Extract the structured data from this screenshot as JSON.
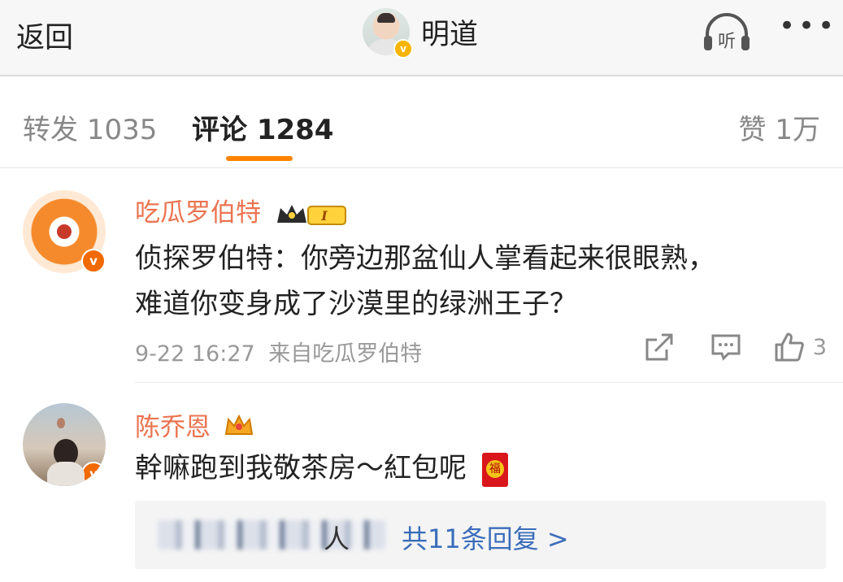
{
  "header": {
    "back_label": "返回",
    "author_name": "明道",
    "listen_label": "听",
    "more_icon": "more-dots-icon"
  },
  "tabs": {
    "repost": "转发 1035",
    "comment": "评论 1284",
    "like": "赞 1万"
  },
  "comments": [
    {
      "user": "吃瓜罗伯特",
      "badge_level": "I",
      "text_line1": "侦探罗伯特：你旁边那盆仙人掌看起来很眼熟，",
      "text_line2": "难道你变身成了沙漠里的绿洲王子？",
      "time": "9-22 16:27",
      "source": "来自吃瓜罗伯特",
      "like_count": "3"
    },
    {
      "user": "陈乔恩",
      "text": "幹嘛跑到我敬茶房～紅包呢",
      "emoji": "福",
      "reply_who": "人",
      "reply_summary": "共11条回复 >"
    }
  ],
  "colors": {
    "accent": "#ff8200",
    "username": "#eb7350",
    "link": "#3b6dba",
    "verified": "#f06a00"
  }
}
